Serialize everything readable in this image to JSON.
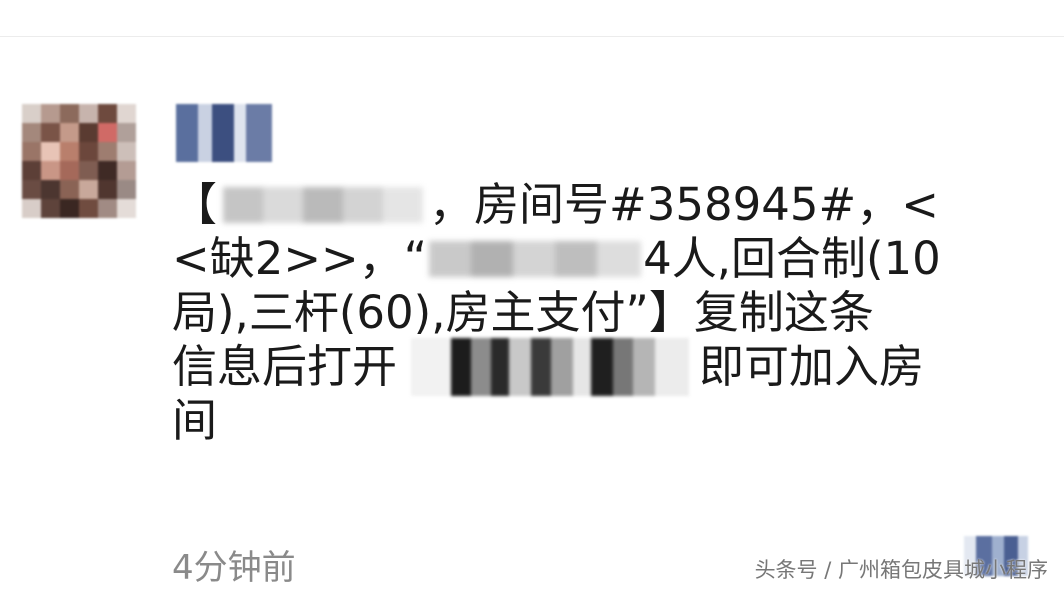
{
  "post": {
    "line1": {
      "open_bracket": "【",
      "text": "，房间号#358945#，<"
    },
    "line2": {
      "prefix": "<缺2>>，“",
      "suffix": "4人,回合制(10"
    },
    "line3": {
      "text": "局),三杆(60),房主支付”】复制这条"
    },
    "line4": {
      "prefix": "信息后打开",
      "suffix": "即可加入房"
    },
    "line5": {
      "text": "间"
    },
    "timestamp": "4分钟前"
  },
  "watermark": {
    "text": "头条号 / 广州箱包皮具城小程序"
  },
  "colors": {
    "text": "#1a1a1a",
    "timestamp": "#8a8a8a",
    "watermark": "#777777",
    "background": "#ffffff"
  },
  "icons": {
    "avatar": "pixelated-avatar-icon",
    "nickname": "pixelated-nickname",
    "corner": "pixelated-corner-icon"
  }
}
